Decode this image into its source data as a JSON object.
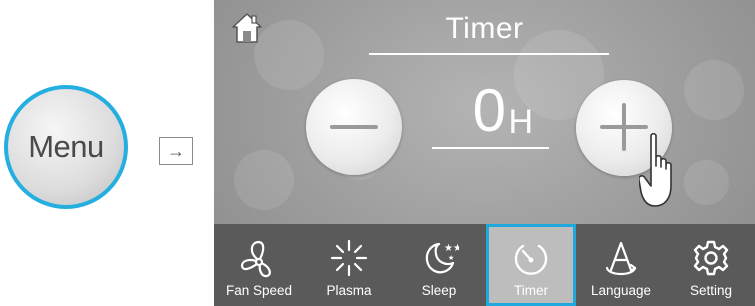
{
  "menu": {
    "label": "Menu",
    "arrow": "→"
  },
  "screen": {
    "title": "Timer",
    "timer_value": "0",
    "timer_unit": "H",
    "buttons": {
      "decrease_icon": "minus-icon",
      "increase_icon": "plus-icon",
      "home_icon": "home-icon"
    }
  },
  "tabs": [
    {
      "label": "Fan Speed",
      "icon": "fan-icon"
    },
    {
      "label": "Plasma",
      "icon": "plasma-icon"
    },
    {
      "label": "Sleep",
      "icon": "sleep-icon"
    },
    {
      "label": "Timer",
      "icon": "timer-icon",
      "selected": true
    },
    {
      "label": "Language",
      "icon": "language-icon"
    },
    {
      "label": "Setting",
      "icon": "gear-icon"
    }
  ],
  "colors": {
    "accent": "#1fa8dc",
    "menu_ring": "#25aee0",
    "bar": "#5a5a5a",
    "screen": "#9c9c9c"
  }
}
